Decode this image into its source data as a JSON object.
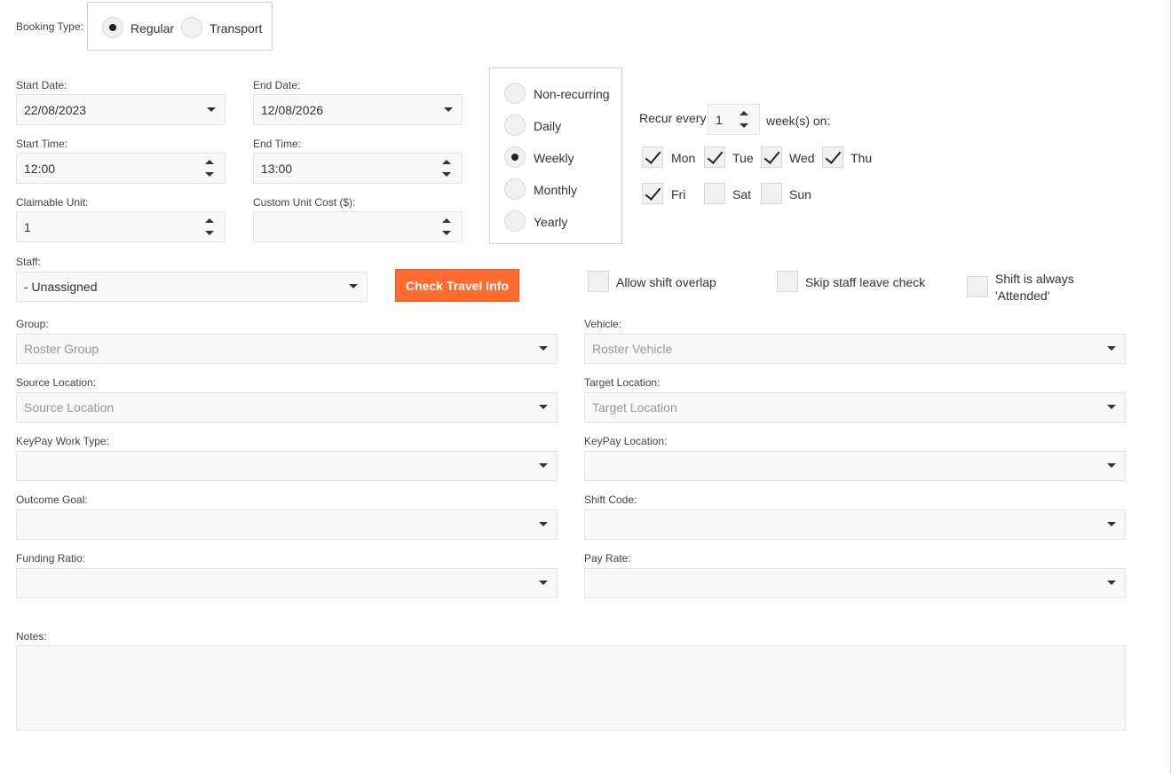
{
  "booking_type": {
    "label": "Booking Type:",
    "options": [
      "Regular",
      "Transport"
    ],
    "selected": "Regular"
  },
  "dates": {
    "start_date_label": "Start Date:",
    "start_date": "22/08/2023",
    "end_date_label": "End Date:",
    "end_date": "12/08/2026",
    "start_time_label": "Start Time:",
    "start_time": "12:00",
    "end_time_label": "End Time:",
    "end_time": "13:00",
    "claimable_unit_label": "Claimable Unit:",
    "claimable_unit": "1",
    "custom_unit_cost_label": "Custom Unit Cost ($):",
    "custom_unit_cost": ""
  },
  "recurrence": {
    "options": [
      "Non-recurring",
      "Daily",
      "Weekly",
      "Monthly",
      "Yearly"
    ],
    "selected": "Weekly",
    "recur_every_label": "Recur every",
    "recur_every_value": "1",
    "weeks_on_label": "week(s) on:",
    "days": [
      {
        "label": "Mon",
        "checked": true
      },
      {
        "label": "Tue",
        "checked": true
      },
      {
        "label": "Wed",
        "checked": true
      },
      {
        "label": "Thu",
        "checked": true
      },
      {
        "label": "Fri",
        "checked": true
      },
      {
        "label": "Sat",
        "checked": false
      },
      {
        "label": "Sun",
        "checked": false
      }
    ]
  },
  "staff": {
    "label": "Staff:",
    "value": "- Unassigned",
    "check_travel_label": "Check Travel Info",
    "allow_overlap_label": "Allow shift overlap",
    "skip_leave_label": "Skip staff leave check",
    "always_attended_line1": "Shift is always",
    "always_attended_line2": "'Attended'"
  },
  "fields": {
    "group_label": "Group:",
    "group_placeholder": "Roster Group",
    "vehicle_label": "Vehicle:",
    "vehicle_placeholder": "Roster Vehicle",
    "source_label": "Source Location:",
    "source_placeholder": "Source Location",
    "target_label": "Target Location:",
    "target_placeholder": "Target Location",
    "keypay_work_type_label": "KeyPay Work Type:",
    "keypay_location_label": "KeyPay Location:",
    "outcome_goal_label": "Outcome Goal:",
    "shift_code_label": "Shift Code:",
    "funding_ratio_label": "Funding Ratio:",
    "pay_rate_label": "Pay Rate:",
    "notes_label": "Notes:"
  },
  "colors": {
    "accent": "#ff6a2f",
    "field_bg": "#f8f8f8",
    "border": "#e4e4e4"
  }
}
